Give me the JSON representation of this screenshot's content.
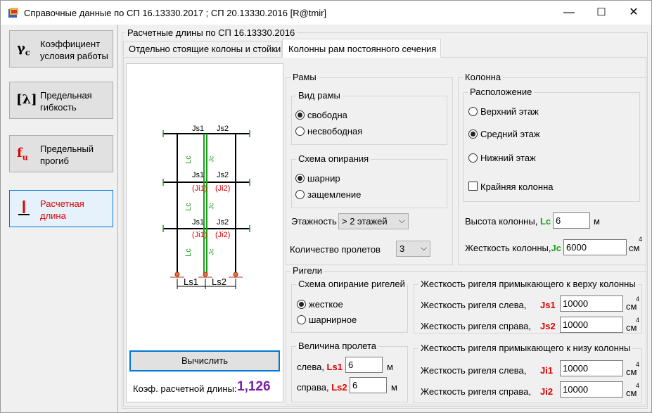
{
  "window": {
    "title": "Справочные данные по СП 16.13330.2017 ; СП 20.13330.2016 [R@tmir]",
    "min": "—",
    "max": "☐",
    "close": "✕"
  },
  "sidebar": {
    "items": [
      {
        "icon": "γc",
        "label": "Коэффициент условия работы"
      },
      {
        "icon": "[λ]",
        "label": "Предельная гибкость"
      },
      {
        "icon": "fu",
        "label": "Предельный прогиб"
      },
      {
        "icon": "⊥",
        "label": "Расчетная длина"
      }
    ]
  },
  "main": {
    "group_title": "Расчетные длины по СП 16.13330.2016",
    "tabs": [
      {
        "label": "Отдельно стоящие колоны и стойки"
      },
      {
        "label": "Колонны рам постоянного сечения"
      }
    ],
    "calc_button": "Вычислить",
    "coef_label": "Коэф. расчетной длины:",
    "coef_value": "1,126"
  },
  "diagram": {
    "js1": "Js1",
    "js2": "Js2",
    "ji1": "(Ji1)",
    "ji2": "(Ji2)",
    "lc": "Lc",
    "jc": "Jc",
    "ls1": "Ls1",
    "ls2": "Ls2"
  },
  "frames": {
    "title": "Рамы",
    "frame_type": {
      "title": "Вид рамы",
      "options": [
        "свободна",
        "несвободная"
      ],
      "selected": 0
    },
    "support": {
      "title": "Схема опирания",
      "options": [
        "шарнир",
        "защемление"
      ],
      "selected": 0
    },
    "floors_label": "Этажность",
    "floors_value": "> 2 этажей",
    "spans_label": "Количество пролетов",
    "spans_value": "3"
  },
  "column": {
    "title": "Колонна",
    "location": {
      "title": "Расположение",
      "options": [
        "Верхний этаж",
        "Средний этаж",
        "Нижний этаж"
      ],
      "selected": 1
    },
    "edge_label": "Крайняя колонна",
    "height_label": "Высота колонны,",
    "height_sym": "Lc",
    "height_value": "6",
    "height_unit": "м",
    "stiff_label": "Жесткость колонны,",
    "stiff_sym": "Jc",
    "stiff_value": "6000",
    "stiff_unit": "см",
    "stiff_pow": "4"
  },
  "beams": {
    "title": "Ригели",
    "support": {
      "title": "Схема опирание ригелей",
      "options": [
        "жесткое",
        "шарнирное"
      ],
      "selected": 0
    },
    "span": {
      "title": "Величина пролета",
      "left_label": "слева,",
      "left_sym": "Ls1",
      "left_value": "6",
      "right_label": "справа,",
      "right_sym": "Ls2",
      "right_value": "6",
      "unit": "м"
    },
    "top": {
      "title": "Жесткость ригеля примыкающего к верху колонны",
      "left_label": "Жесткость ригеля слева,",
      "left_sym": "Js1",
      "left_value": "10000",
      "right_label": "Жесткость ригеля справа,",
      "right_sym": "Js2",
      "right_value": "10000"
    },
    "bottom": {
      "title": "Жесткость ригеля примыкающего к низу колонны",
      "left_label": "Жесткость ригеля слева,",
      "left_sym": "Ji1",
      "left_value": "10000",
      "right_label": "Жесткость ригеля справа,",
      "right_sym": "Ji2",
      "right_value": "10000"
    },
    "unit": "см",
    "pow": "4"
  },
  "colors": {
    "accent": "#0078d7",
    "red": "#e00000",
    "green": "#1aa31a",
    "purple": "#7a1fa2"
  }
}
